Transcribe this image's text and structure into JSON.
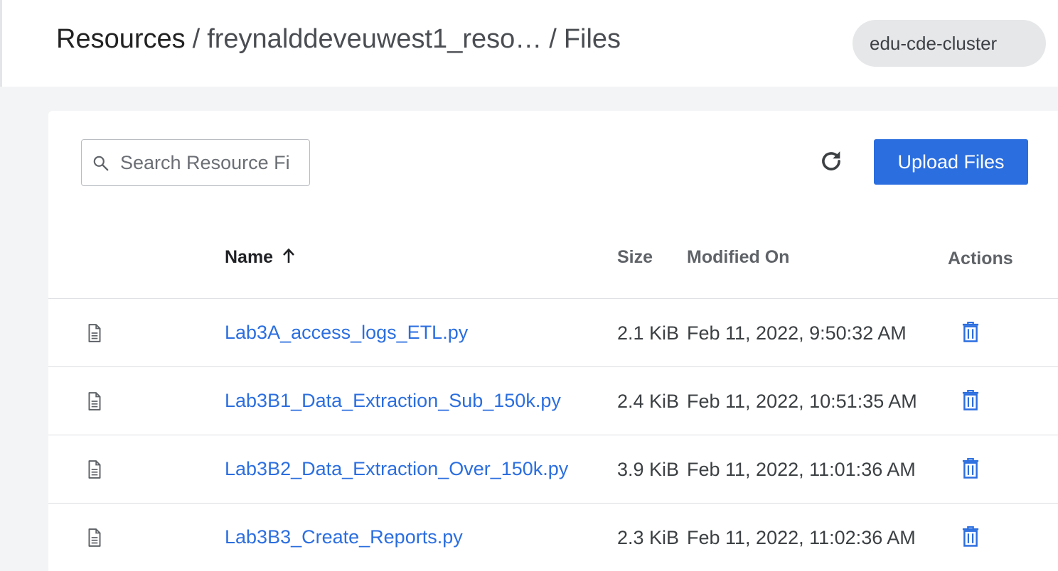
{
  "breadcrumb": {
    "root": "Resources",
    "separator": "/",
    "resource": "freynalddeveuwest1_reso…",
    "current": "Files"
  },
  "cluster": {
    "name": "edu-cde-cluster"
  },
  "toolbar": {
    "search_placeholder": "Search Resource Fi",
    "upload_label": "Upload Files",
    "refresh_icon": "refresh-icon"
  },
  "table": {
    "columns": {
      "name": "Name",
      "size": "Size",
      "modified": "Modified On",
      "actions": "Actions"
    },
    "sort": {
      "column": "Name",
      "direction": "ascending"
    },
    "rows": [
      {
        "name": "Lab3A_access_logs_ETL.py",
        "size": "2.1 KiB",
        "modified": "Feb 11, 2022, 9:50:32 AM"
      },
      {
        "name": "Lab3B1_Data_Extraction_Sub_150k.py",
        "size": "2.4 KiB",
        "modified": "Feb 11, 2022, 10:51:35 AM"
      },
      {
        "name": "Lab3B2_Data_Extraction_Over_150k.py",
        "size": "3.9 KiB",
        "modified": "Feb 11, 2022, 11:01:36 AM"
      },
      {
        "name": "Lab3B3_Create_Reports.py",
        "size": "2.3 KiB",
        "modified": "Feb 11, 2022, 11:02:36 AM"
      }
    ]
  },
  "colors": {
    "accent": "#2b6edf",
    "page_background": "#f3f4f5",
    "pill_background": "#e6e7e9"
  }
}
